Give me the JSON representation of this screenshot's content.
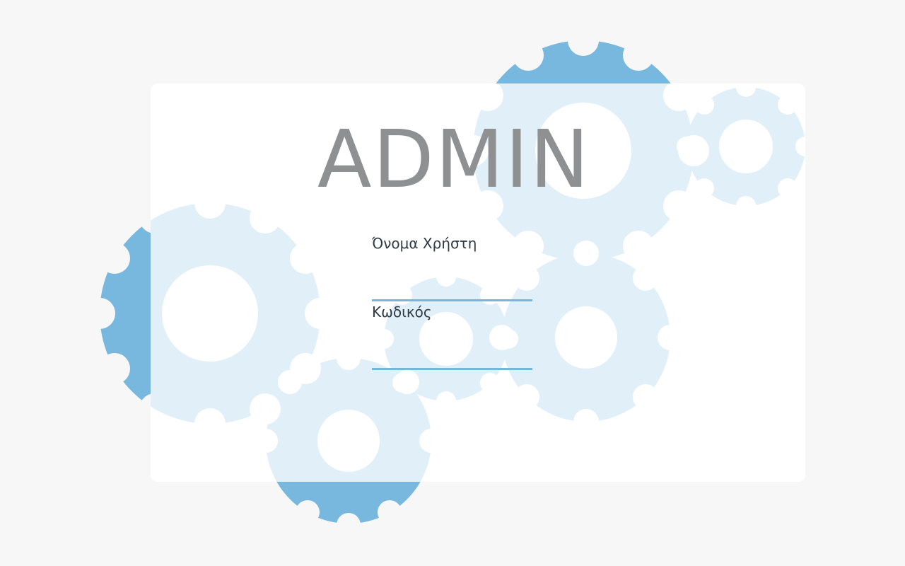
{
  "page": {
    "title": "ADMIN"
  },
  "form": {
    "username_label": "Όνομα Χρήστη",
    "username_value": "",
    "password_label": "Κωδικός",
    "password_value": ""
  },
  "colors": {
    "background": "#f7f7f7",
    "card": "#ffffff",
    "gear_dark": "#78b8de",
    "gear_light": "#e1f0f8",
    "title": "#8f9091",
    "label": "#2e3a44",
    "input_underline": "#74b6dc"
  },
  "icons": {
    "decoration": "gear-icon"
  }
}
